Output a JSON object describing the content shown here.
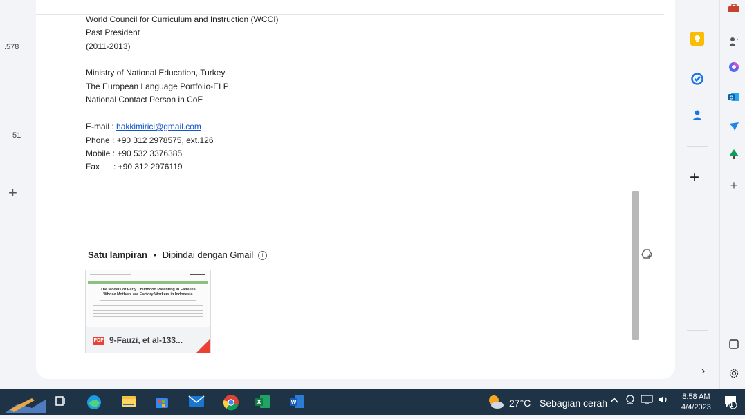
{
  "left_strip": {
    "num1": ".578",
    "num2": "51",
    "plus": "+"
  },
  "signature": {
    "org_line1": "World Council for Curriculum and Instruction (WCCI)",
    "org_line2": "Past President",
    "org_line3": "(2011-2013)",
    "ministry_line1": "Ministry of National Education, Turkey",
    "ministry_line2": "The European Language Portfolio-ELP",
    "ministry_line3": "National Contact Person in CoE",
    "email_label": "E-mail : ",
    "email_value": "hakkimirici@gmail.com",
    "phone": "Phone : +90 312 2978575, ext.126",
    "mobile": "Mobile : +90 532 3376385",
    "fax": "Fax      : +90 312 2976119"
  },
  "attachment_section": {
    "title": "Satu lampiran",
    "separator": "•",
    "subtitle": "Dipindai dengan Gmail",
    "info_icon": "i",
    "drive_icon": "drive-add-icon"
  },
  "attachment": {
    "type_badge": "PDF",
    "name": "9-Fauzi, et al-133...",
    "preview_title_line1": "The Models of Early Childhood Parenting in Families",
    "preview_title_line2": "Whose Mothers are Factory Workers in Indonesia"
  },
  "addon_panel": {
    "plus": "+",
    "chevron": "›"
  },
  "taskbar": {
    "temperature": "27°C",
    "weather": "Sebagian cerah",
    "time": "8:58 AM",
    "date": "4/4/2023",
    "notification_count": "1"
  },
  "colors": {
    "link": "#1155cc",
    "taskbar": "#1f3346",
    "pdf_red": "#e94235"
  }
}
